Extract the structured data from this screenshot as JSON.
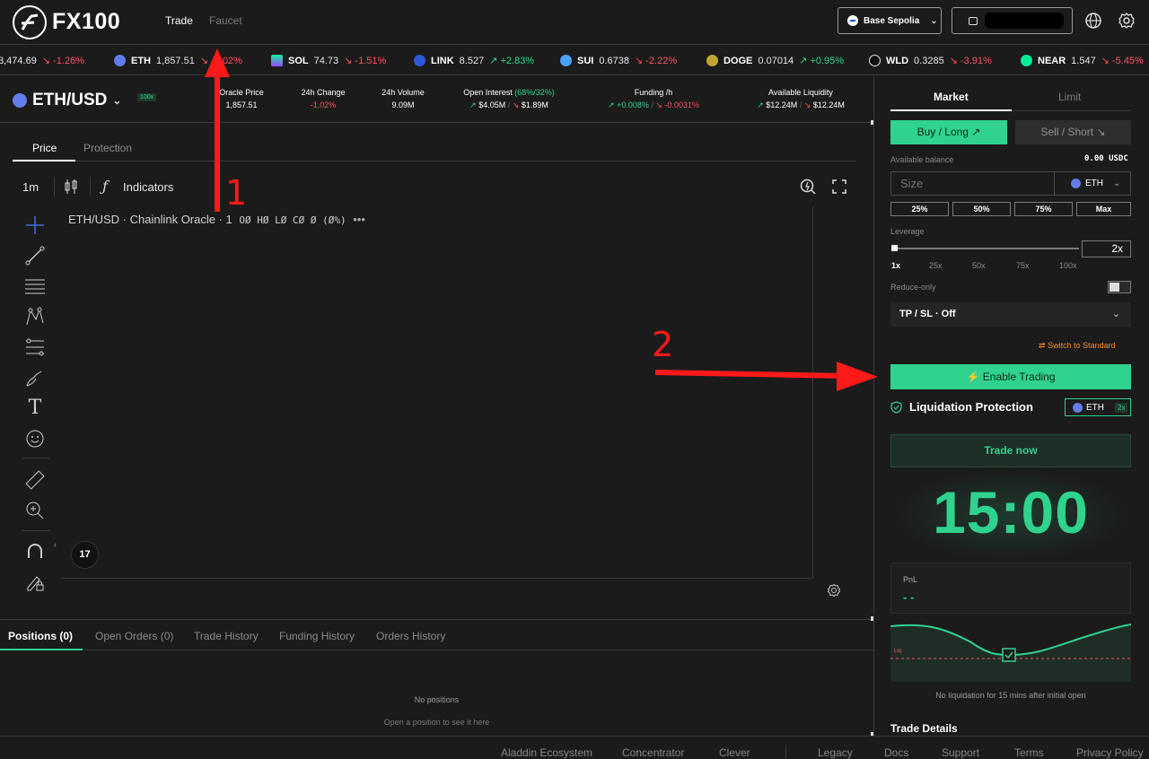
{
  "header": {
    "logo_text": "FX100",
    "nav": [
      {
        "label": "Trade",
        "active": true
      },
      {
        "label": "Faucet",
        "active": false
      }
    ],
    "network": "Base Sepolia",
    "icons": [
      "globe-icon",
      "gear-icon"
    ]
  },
  "ticker": [
    {
      "symbol": "",
      "price": "3,474.69",
      "change": "↘ -1.26%",
      "dir": "down",
      "color": ""
    },
    {
      "symbol": "ETH",
      "price": "1,857.51",
      "change": "↘ -1.02%",
      "dir": "down",
      "color": "#627eea"
    },
    {
      "symbol": "SOL",
      "price": "74.73",
      "change": "↘ -1.51%",
      "dir": "down",
      "color": "#9945ff"
    },
    {
      "symbol": "LINK",
      "price": "8.527",
      "change": "↗ +2.83%",
      "dir": "up",
      "color": "#2a5ada"
    },
    {
      "symbol": "SUI",
      "price": "0.6738",
      "change": "↘ -2.22%",
      "dir": "down",
      "color": "#4da2ff"
    },
    {
      "symbol": "DOGE",
      "price": "0.07014",
      "change": "↗ +0.95%",
      "dir": "up",
      "color": "#c2a633"
    },
    {
      "symbol": "WLD",
      "price": "0.3285",
      "change": "↘ -3.91%",
      "dir": "down",
      "color": "#e6e6e6"
    },
    {
      "symbol": "NEAR",
      "price": "1.547",
      "change": "↘ -5.45%",
      "dir": "down",
      "color": "#00ec97"
    }
  ],
  "market": {
    "pair": "ETH/USD",
    "leverage_badge": "100x",
    "stats": [
      {
        "label": "Oracle Price",
        "value": "1,857.51"
      },
      {
        "label": "24h Change",
        "value": "-1.02%"
      },
      {
        "label": "24h Volume",
        "value": "9.09M"
      },
      {
        "label": "Open Interest",
        "label_pct": "(68%/32%)",
        "long": "$4.05M",
        "short": "$1.89M"
      },
      {
        "label": "Funding /h",
        "long": "+0.008%",
        "short": "-0.0031%"
      },
      {
        "label": "Available Liquidity",
        "long": "$12.24M",
        "short": "$12.24M"
      }
    ]
  },
  "chart": {
    "tabs": [
      {
        "label": "Price",
        "active": true
      },
      {
        "label": "Protection",
        "active": false
      }
    ],
    "interval": "1m",
    "indicators_label": "Indicators",
    "legend_title": "ETH/USD · Chainlink Oracle · 1",
    "legend_ohlc": "OØ HØ LØ CØ Ø (Ø%)",
    "tv_logo": "17"
  },
  "positions": {
    "tabs": [
      {
        "label": "Positions",
        "count": "(0)",
        "active": true
      },
      {
        "label": "Open Orders",
        "count": "(0)",
        "active": false
      },
      {
        "label": "Trade History",
        "count": "",
        "active": false
      },
      {
        "label": "Funding History",
        "count": "",
        "active": false
      },
      {
        "label": "Orders History",
        "count": "",
        "active": false
      }
    ],
    "empty_title": "No positions",
    "empty_sub": "Open a position to see it here"
  },
  "order": {
    "tabs": [
      {
        "label": "Market",
        "active": true
      },
      {
        "label": "Limit",
        "active": false
      }
    ],
    "buy_label": "Buy / Long",
    "sell_label": "Sell / Short",
    "balance_label": "Available balance",
    "balance_value": "0.00 USDC",
    "size_placeholder": "Size",
    "size_token": "ETH",
    "percents": [
      "25%",
      "50%",
      "75%",
      "Max"
    ],
    "leverage_label": "Leverage",
    "leverage_value": "2x",
    "leverage_level": 2,
    "leverage_ticks": [
      "1x",
      "25x",
      "50x",
      "75x",
      "100x"
    ],
    "reduce_only_label": "Reduce-only",
    "tpsl_label": "TP / SL · Off",
    "switch_label": "Switch to Standard",
    "enable_label": "Enable Trading",
    "liq_title": "Liquidation Protection",
    "liq_token": "ETH",
    "liq_lev": "2x",
    "trade_now": "Trade now",
    "timer": "15:00",
    "pnl_label": "PnL",
    "pnl_value": "- -",
    "liq_line_label": "Liq.",
    "no_liq_text": "No liquidation for 15 mins after initial open",
    "trade_details": "Trade Details"
  },
  "footer": {
    "links": [
      "Aladdin Ecosystem",
      "Concentrator",
      "Clever",
      "Legacy",
      "Docs",
      "Support",
      "Terms",
      "Privacy Policy"
    ]
  },
  "annotations": {
    "arrow1": "1",
    "arrow2": "2"
  },
  "colors": {
    "accent": "#2fd28e",
    "down": "#ff4d5e",
    "up": "#2ed68a",
    "annotation": "#ff1a1a"
  }
}
